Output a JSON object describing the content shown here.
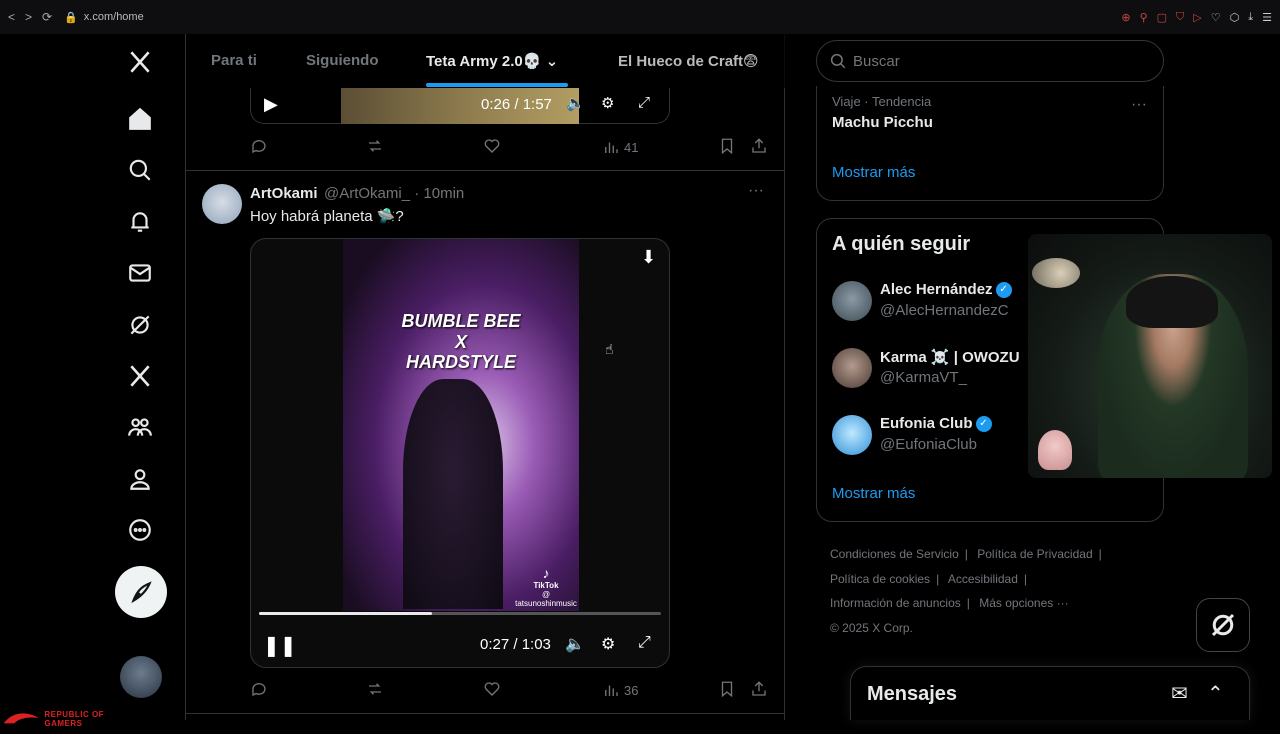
{
  "browser": {
    "url": "x.com/home"
  },
  "tabs": [
    {
      "label": "Para ti"
    },
    {
      "label": "Siguiendo"
    },
    {
      "label": "Teta Army 2.0💀"
    },
    {
      "label": "El Hueco de Craft😨"
    }
  ],
  "prev_tweet": {
    "video_time": "0:26 / 1:57",
    "views": "41"
  },
  "tweet": {
    "name": "ArtOkami",
    "handle": "@ArtOkami_",
    "time": "· 10min",
    "text": "Hoy habrá planeta 🛸?",
    "overlay_line1": "BUMBLE BEE",
    "overlay_line2": "X",
    "overlay_line3": "HARDSTYLE",
    "tiktok_label": "TikTok",
    "tiktok_user": "@ tatsunoshinmusic",
    "video_time": "0:27 / 1:03",
    "progress": 0.43,
    "views": "36"
  },
  "search": {
    "placeholder": "Buscar"
  },
  "trend": {
    "meta": "Viaje · Tendencia",
    "title": "Machu Picchu",
    "show_more": "Mostrar más"
  },
  "who_to_follow": {
    "title": "A quién seguir",
    "accounts": [
      {
        "name": "Alec Hernández",
        "handle": "@AlecHernandezC",
        "verified": "✓"
      },
      {
        "name": "Karma ☠️ | OWOZU",
        "handle": "@KarmaVT_"
      },
      {
        "name": "Eufonia Club",
        "handle": "@EufoniaClub",
        "verified": "✓"
      }
    ],
    "show_more": "Mostrar más"
  },
  "footer": {
    "links": [
      "Condiciones de Servicio",
      "|",
      "Política de Privacidad",
      "|",
      "Política de cookies",
      "|",
      "Accesibilidad",
      "|",
      "Información de anuncios",
      "|",
      "Más opciones ···"
    ],
    "copyright": "© 2025 X Corp."
  },
  "messages": {
    "title": "Mensajes"
  },
  "branding": {
    "rog_text": "REPUBLIC OF GAMERS"
  },
  "colors": {
    "accent": "#1d9bf0",
    "background": "#000000",
    "border": "#2f3336",
    "muted_text": "#71767b"
  }
}
